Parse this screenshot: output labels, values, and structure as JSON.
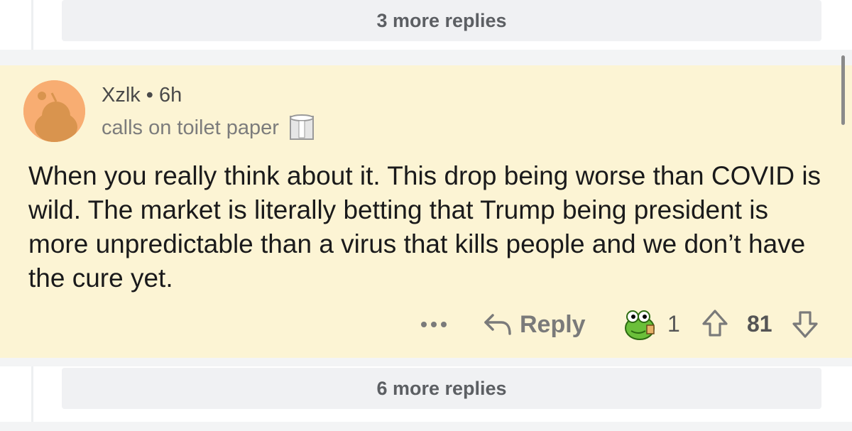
{
  "top_replies": {
    "label": "3 more replies"
  },
  "comment": {
    "username": "Xzlk",
    "separator": "•",
    "time": "6h",
    "flair": "calls on toilet paper",
    "body": "When you really think about it. This drop being worse than COVID is wild. The market is literally betting that Trump being president is more unpredictable than a virus that kills people and we don’t have the cure yet.",
    "actions": {
      "reply_label": "Reply",
      "award_count": "1",
      "score": "81"
    }
  },
  "bottom_replies": {
    "label": "6 more replies"
  },
  "icons": {
    "more": "ellipsis-icon",
    "reply": "reply-arrow-icon",
    "award": "frog-award-icon",
    "upvote": "upvote-arrow-icon",
    "downvote": "downvote-arrow-icon",
    "flair": "toilet-paper-icon"
  },
  "colors": {
    "highlight_bg": "#fcf4d4",
    "avatar_bg": "#f8ad72",
    "replies_bg": "#f0f1f3"
  }
}
